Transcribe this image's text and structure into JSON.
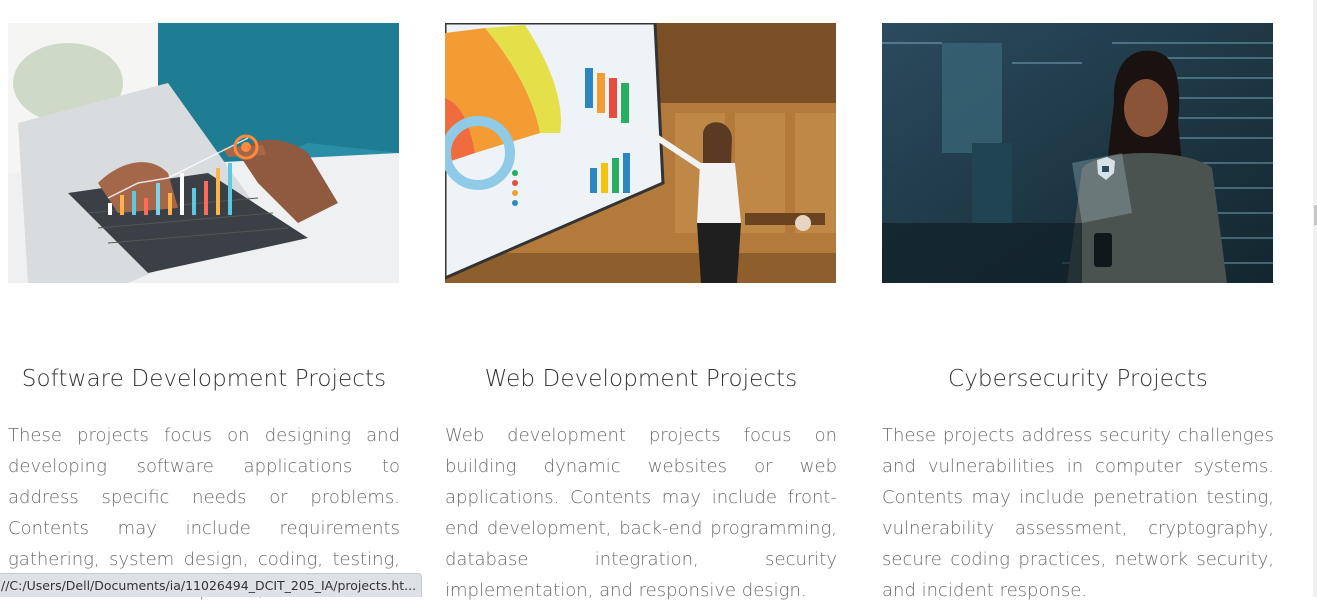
{
  "cards": [
    {
      "image_alt": "Hand pointing at rising bar chart hologram over laptop",
      "title": "Software Development Projects",
      "description": "These projects focus on designing and developing software applications to address specific needs or problems. Contents may include requirements gathering, system design, coding, testing, user interface development,"
    },
    {
      "image_alt": "Woman presenting charts on a large wall screen",
      "title": "Web Development Projects",
      "description": "Web development projects focus on building dynamic websites or web applications. Contents may include front-end development, back-end programming, database integration, security implementation, and responsive design."
    },
    {
      "image_alt": "Woman with phone in front of code and security lock overlay",
      "title": "Cybersecurity Projects",
      "description": "These projects address security challenges and vulnerabilities in computer systems. Contents may include penetration testing, vulnerability assessment, cryptography, secure coding practices, network security, and incident response."
    }
  ],
  "status_bar": {
    "url": "//C:/Users/Dell/Documents/ia/11026494_DCIT_205_IA/projects.ht..."
  }
}
